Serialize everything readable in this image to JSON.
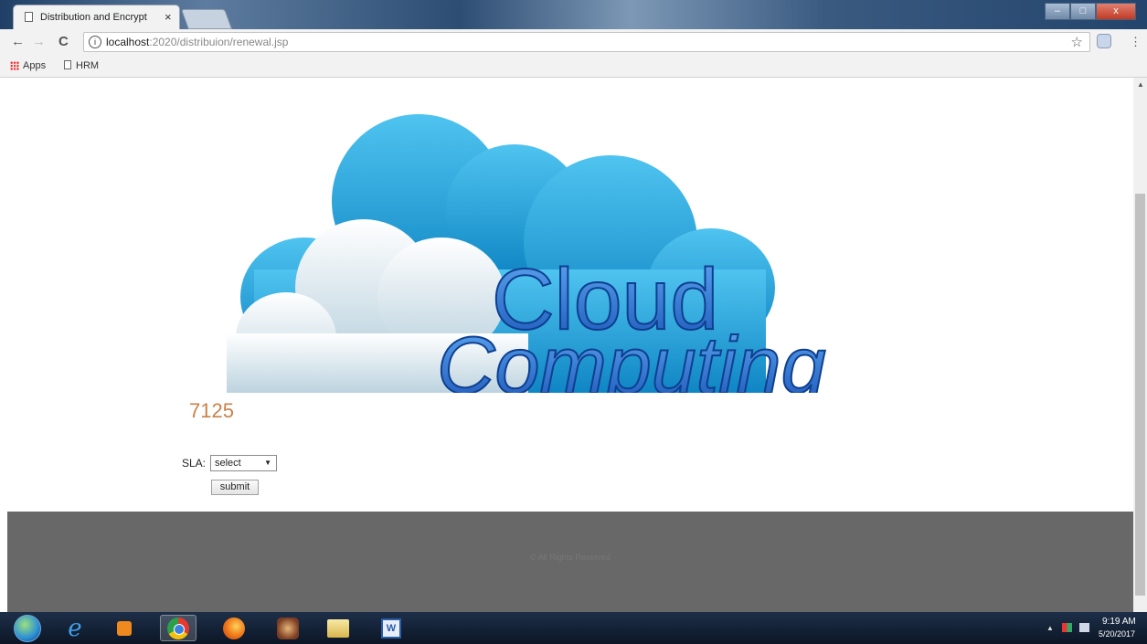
{
  "browser": {
    "tab_title": "Distribution and Encrypt",
    "tab_close": "×",
    "url_host": "localhost",
    "url_path": ":2020/distribuion/renewal.jsp",
    "icons": [
      "back-icon",
      "forward-icon",
      "reload-icon",
      "info-icon",
      "star-icon",
      "extension-icon",
      "menu-icon"
    ],
    "nav": {
      "back": "←",
      "forward": "→",
      "reload": "C",
      "star": "☆",
      "menu": "⋮",
      "info": "i"
    },
    "window_controls": {
      "minimize": "–",
      "maximize": "□",
      "close": "x"
    }
  },
  "bookmarks": [
    {
      "label": "Apps",
      "icon": "apps-grid-icon"
    },
    {
      "label": "HRM",
      "icon": "page-icon"
    }
  ],
  "banner": {
    "line1": "Cloud",
    "line2": "Computing",
    "colors": {
      "cloud_back": "#1fa6dd",
      "cloud_front": "#e9f3f8",
      "text": "#2f7fd6"
    }
  },
  "main": {
    "count": "7125",
    "sla_label": "SLA:",
    "sla_selected": "select",
    "submit_label": "submit"
  },
  "footer": {
    "text": "© All Rights Reserved",
    "color": "#686868"
  },
  "taskbar": {
    "items": [
      "start-orb-icon",
      "internet-explorer-icon",
      "media-player-icon",
      "chrome-icon",
      "firefox-icon",
      "app-icon",
      "file-explorer-icon",
      "word-icon"
    ],
    "active": "chrome-icon",
    "clock_time": "9:19 AM",
    "clock_date": "5/20/2017"
  }
}
